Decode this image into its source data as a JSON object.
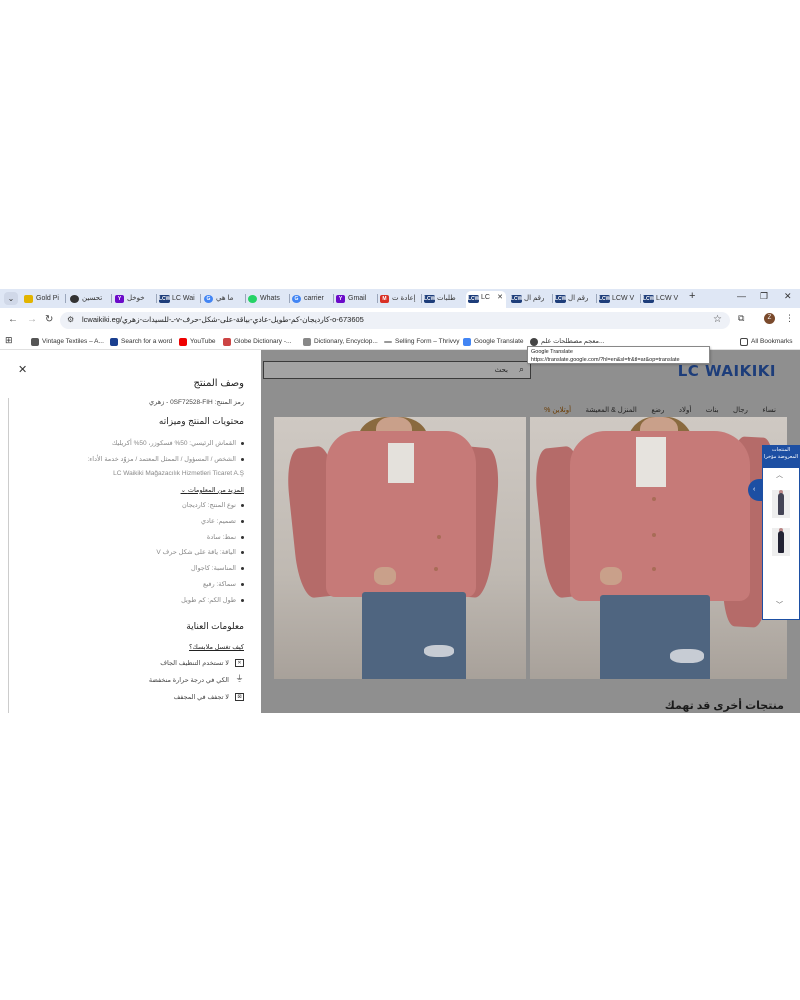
{
  "browser": {
    "tabs": [
      {
        "label": "Gold Pi",
        "icon": "gold-tab-icon"
      },
      {
        "label": "تحسين",
        "icon": "chatgpt-tab-icon"
      },
      {
        "label": "خوخل",
        "icon": "yahoo-tab-icon"
      },
      {
        "label": "LC Wai",
        "icon": "lcw-tab-icon"
      },
      {
        "label": "ما هي",
        "icon": "google-tab-icon"
      },
      {
        "label": "Whats",
        "icon": "whatsapp-tab-icon"
      },
      {
        "label": "carrier",
        "icon": "google-tab-icon"
      },
      {
        "label": "Gmail",
        "icon": "yahoo-tab-icon"
      },
      {
        "label": "إعادة ت",
        "icon": "gmail-tab-icon"
      },
      {
        "label": "طلبات",
        "icon": "lcw-tab-icon"
      },
      {
        "label": "LC",
        "icon": "lcw-tab-icon"
      },
      {
        "label": "رقم ال",
        "icon": "lcw-tab-icon"
      },
      {
        "label": "رقم ال",
        "icon": "lcw-tab-icon"
      },
      {
        "label": "LCW V",
        "icon": "lcw-tab-icon"
      },
      {
        "label": "LCW V",
        "icon": "lcw-tab-icon"
      }
    ],
    "new_tab": "+",
    "url": "lcwaikiki.eg/ـ-للسيدات-زهري-v-كارديجان-كم-طويل-عادي-بياقة-على-شكل-حرف-o-673605",
    "bookmarks": [
      {
        "label": "Vintage Textiles – A..."
      },
      {
        "label": "Search for a word"
      },
      {
        "label": "YouTube"
      },
      {
        "label": "Globe Dictionary -..."
      },
      {
        "label": "Dictionary, Encyclop..."
      },
      {
        "label": "Selling Form – Thrivvy"
      },
      {
        "label": "Google Translate"
      },
      {
        "label": "معجم مصطلحات علم..."
      }
    ],
    "all_bookmarks": "All Bookmarks",
    "tooltip": {
      "title": "Google Translate",
      "url": "https://translate.google.com/?hl=en&sl=fr&tl=ar&op=translate"
    },
    "profile_initial": "Z"
  },
  "site": {
    "logo": "LC WAIKIKI",
    "search_placeholder": "بحث",
    "categories": [
      "نساء",
      "رجال",
      "بنات",
      "أولاد",
      "رضع",
      "المنزل & المعيشة",
      "أوتلاين %"
    ],
    "more_products": "منتجات أخرى قد تهمك",
    "side_panel_title": "المنتجات المعروضة مؤخرا"
  },
  "drawer": {
    "title": "وصف المنتج",
    "code": "رمز المنتج: 0SF72528-FIH - زهري",
    "contents_title": "محتويات المنتج وميزاته",
    "bullets": [
      "القماش الرئيسي: 50% فسكوزر، 50% أكريليك",
      "الشخص / المسؤول / الممثل المعتمد / مزوّد خدمة الأداء:",
      "LC Waikiki Mağazacılık Hizmetleri Ticaret A.Ş"
    ],
    "more_info": "المزيد من المعلومات",
    "details": [
      "نوع المنتج: كارديجان",
      "تصميم: عادي",
      "نمط: سادة",
      "الياقة: ياقة على شكل حرف V",
      "المناسبة: كاجوال",
      "سماكة: رفيع",
      "طول الكم: كم طويل"
    ],
    "care_title": "معلومات العناية",
    "care_link": "كيف تغسل ملابسك؟",
    "care": [
      "لا تستخدم التنظيف الجاف",
      "الكي في درجة حرارة منخفضة",
      "لا تجفف في المجفف"
    ]
  }
}
